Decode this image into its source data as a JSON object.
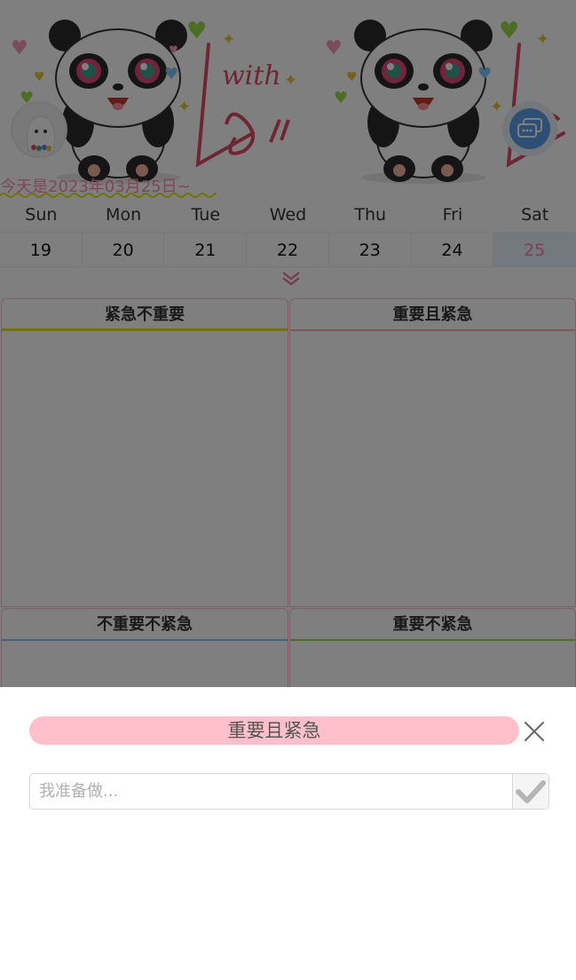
{
  "header": {
    "today_text": "今天是2023年03月25日~",
    "decor_text": "with"
  },
  "calendar": {
    "weekdays": [
      "Sun",
      "Mon",
      "Tue",
      "Wed",
      "Thu",
      "Fri",
      "Sat"
    ],
    "dates": [
      "19",
      "20",
      "21",
      "22",
      "23",
      "24",
      "25"
    ],
    "selected_index": 6
  },
  "quadrants": [
    {
      "label": "紧急不重要",
      "accent": "#e6e600"
    },
    {
      "label": "重要且紧急",
      "accent": "#f4b3c2"
    },
    {
      "label": "不重要不紧急",
      "accent": "#86c5f7"
    },
    {
      "label": "重要不紧急",
      "accent": "#9ad94d"
    }
  ],
  "sheet": {
    "title": "重要且紧急",
    "input_placeholder": "我准备做...",
    "input_value": ""
  },
  "icons": {
    "close": "close-icon",
    "confirm": "check-icon",
    "chat": "chat-bubbles-icon",
    "expand": "double-chevron-down-icon"
  },
  "colors": {
    "sheet_title_bg": "#ffc0cb",
    "today_text": "#ff8fb0",
    "selected_date_bg": "#e8f1ff",
    "overlay": "rgba(0,0,0,0.5)"
  }
}
